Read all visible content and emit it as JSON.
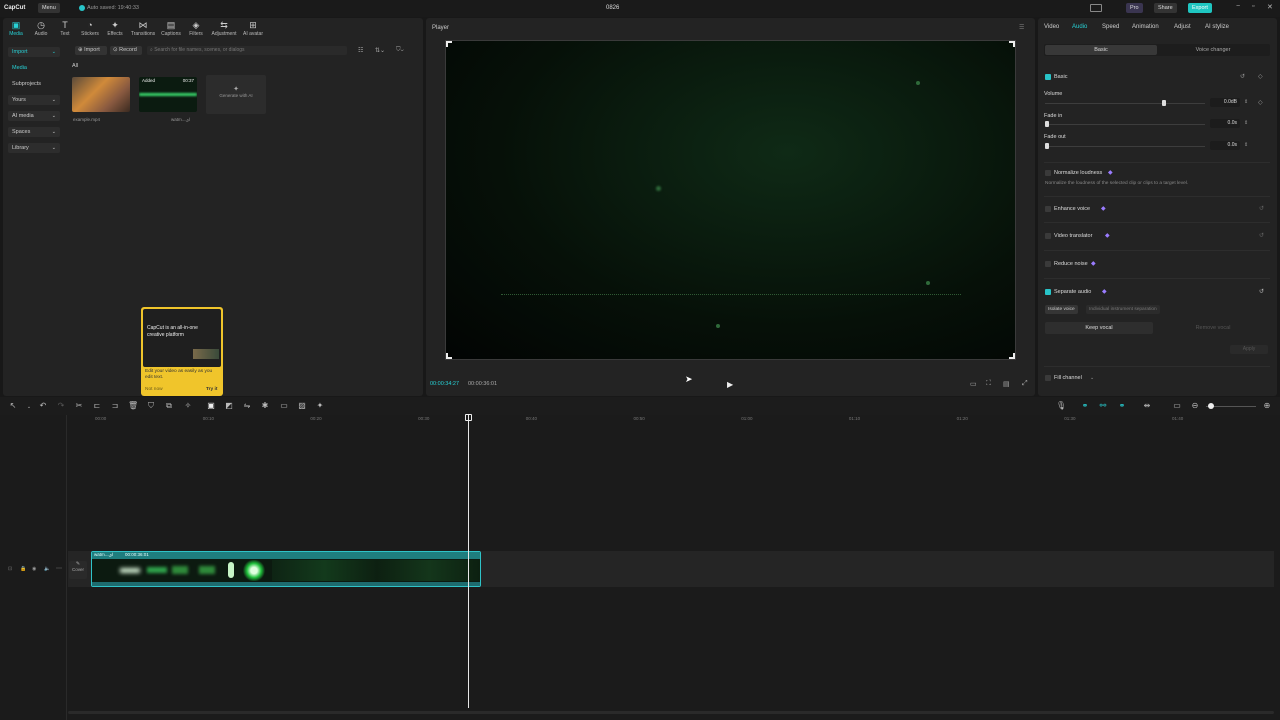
{
  "app": {
    "logo": "CapCut",
    "menu": "Menu",
    "autosave": "Auto saved: 19:40:33",
    "project_title": "0826",
    "pro": "Pro",
    "share": "Share",
    "export": "Export"
  },
  "toolbar": [
    {
      "label": "Media",
      "icon": "media-icon"
    },
    {
      "label": "Audio",
      "icon": "audio-icon"
    },
    {
      "label": "Text",
      "icon": "text-icon"
    },
    {
      "label": "Stickers",
      "icon": "stickers-icon"
    },
    {
      "label": "Effects",
      "icon": "effects-icon"
    },
    {
      "label": "Transitions",
      "icon": "transitions-icon"
    },
    {
      "label": "Captions",
      "icon": "captions-icon"
    },
    {
      "label": "Filters",
      "icon": "filters-icon"
    },
    {
      "label": "Adjustment",
      "icon": "adjustment-icon"
    },
    {
      "label": "AI avatar",
      "icon": "ai-avatar-icon"
    }
  ],
  "sidebar": [
    "Import",
    "Media",
    "Subprojects",
    "Yours",
    "AI media",
    "Spaces",
    "Library"
  ],
  "media": {
    "import": "Import",
    "record": "Record",
    "search_placeholder": "Search for file names, scenes, or dialogs",
    "filter_all": "All",
    "clips": [
      {
        "name": "example.mp4",
        "badge": "",
        "duration": ""
      },
      {
        "name": "watm...ای",
        "badge": "Added",
        "duration": "00:37"
      }
    ],
    "generate_ai": "Generate with AI"
  },
  "tooltip": {
    "title": "CapCut is an all-in-one creative platform",
    "body": "Edit your video as easily as you edit text.",
    "dismiss": "Not now",
    "action": "Try it"
  },
  "player": {
    "title": "Player",
    "current_time": "00:00:34:27",
    "total_time": "00:00:36:01"
  },
  "inspector": {
    "tabs": [
      "Video",
      "Audio",
      "Speed",
      "Animation",
      "Adjust",
      "AI stylize"
    ],
    "active_tab": "Audio",
    "subtabs": [
      "Basic",
      "Voice changer"
    ],
    "basic": "Basic",
    "volume": {
      "label": "Volume",
      "value": "0.0dB"
    },
    "fade_in": {
      "label": "Fade in",
      "value": "0.0s"
    },
    "fade_out": {
      "label": "Fade out",
      "value": "0.0s"
    },
    "normalize": {
      "label": "Normalize loudness",
      "desc": "Normalize the loudness of the selected clip or clips to a target level."
    },
    "enhance": "Enhance voice",
    "translator": "Video translator",
    "reduce_noise": "Reduce noise",
    "separate": {
      "label": "Separate audio",
      "chips": [
        "Isolate voice",
        "Individual instrument separation"
      ],
      "keep": "Keep vocal",
      "remove": "Remove vocal",
      "apply": "Apply"
    },
    "fill_channel": "Fill channel"
  },
  "timeline": {
    "ruler": [
      "00:00",
      "00:10",
      "00:20",
      "00:30",
      "00:40",
      "00:50",
      "01:00",
      "01:10",
      "01:20",
      "01:30",
      "01:40"
    ],
    "cover": "Cover",
    "clip_name": "watm...ای",
    "clip_duration": "00:00:36:01",
    "playhead_progress": 0.967
  },
  "colors": {
    "accent": "#28d2d6",
    "export": "#1fc6c1",
    "tooltip": "#f0c52b"
  }
}
